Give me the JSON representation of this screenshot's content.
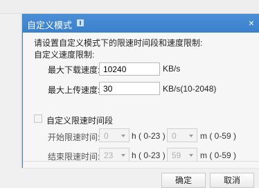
{
  "dialog": {
    "title": "自定义模式",
    "description": "请设置自定义模式下的限速时间段和速度限制:",
    "speed_section_label": "自定义速度限制:",
    "max_download_label": "最大下载速度:",
    "max_download_value": "10240",
    "download_unit": "KB/s",
    "max_upload_label": "最大上传速度:",
    "max_upload_value": "30",
    "upload_unit": "KB/s(10-2048)",
    "time_limit_checkbox_label": "自定义限速时间段",
    "time_limit_checked": false,
    "start_time_label": "开始限速时间:",
    "start_hour": "0",
    "start_minute": "0",
    "end_time_label": "结束限速时间:",
    "end_hour": "23",
    "end_minute": "59",
    "hour_range": "h ( 0-23 )",
    "minute_range": "m ( 0-59 )",
    "ok_button": "确定",
    "cancel_button": "取消"
  },
  "icons": {
    "info": "info-icon",
    "close": "close-icon",
    "dropdown": "chevron-down-icon"
  },
  "colors": {
    "titlebar": "#3b80cb",
    "background": "#f6f6f6"
  }
}
